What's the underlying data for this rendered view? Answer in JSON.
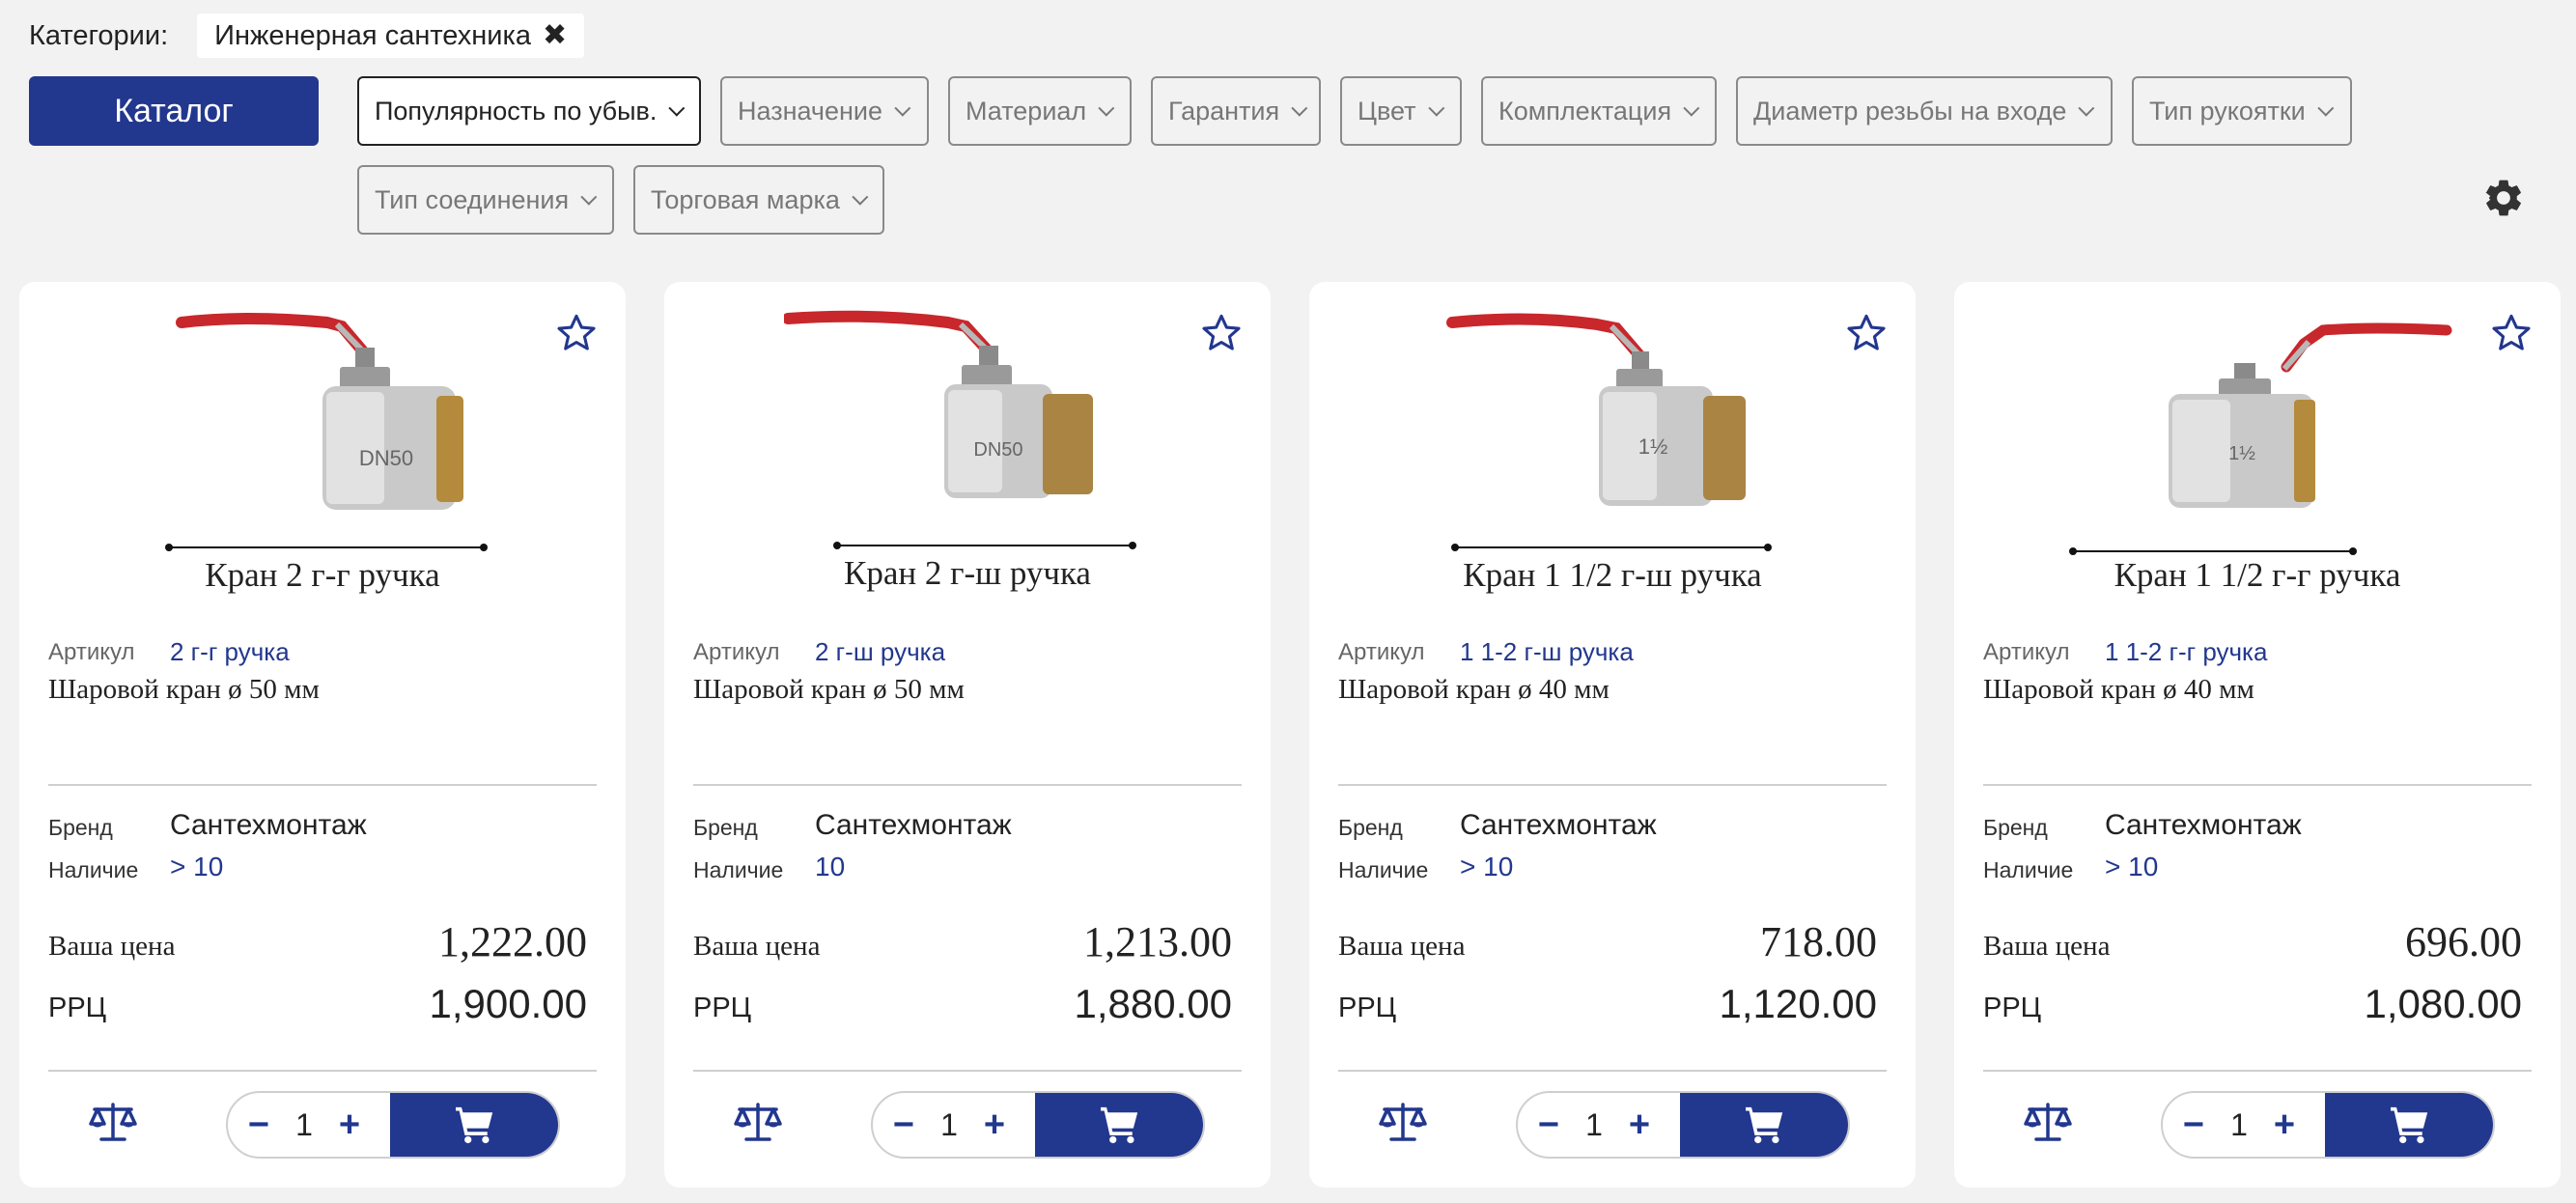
{
  "categories": {
    "label": "Категории:",
    "chip": "Инженерная сантехника",
    "chip_remove": "✖"
  },
  "catalog_button": "Каталог",
  "sort": "Популярность по убыв.",
  "filters": {
    "purpose": "Назначение",
    "material": "Материал",
    "warranty": "Гарантия",
    "color": "Цвет",
    "kit": "Комплектация",
    "thread_diameter": "Диаметр резьбы на входе",
    "handle_type": "Тип рукоятки",
    "connection_type": "Тип соединения",
    "brand": "Торговая марка"
  },
  "icons": {
    "settings": "gear-icon",
    "favorite": "star-icon",
    "compare": "scales-icon",
    "cart": "cart-icon"
  },
  "colors": {
    "accent": "#22378e",
    "handle_red": "#c8272c",
    "background": "#f2f2f2"
  },
  "labels": {
    "article": "Артикул",
    "brand": "Бренд",
    "stock": "Наличие",
    "your_price": "Ваша цена",
    "rrp": "РРЦ",
    "minus": "−",
    "plus": "+"
  },
  "products": [
    {
      "title": "Кран 2 г-г ручка",
      "article": "2 г-г ручка",
      "description": "Шаровой кран ø 50 мм",
      "brand": "Сантехмонтаж",
      "stock": "> 10",
      "price": "1,222.00",
      "rrp": "1,900.00",
      "qty": "1",
      "image_text": "DN50"
    },
    {
      "title": "Кран 2 г-ш ручка",
      "article": "2 г-ш ручка",
      "description": "Шаровой кран ø 50 мм",
      "brand": "Сантехмонтаж",
      "stock": "10",
      "price": "1,213.00",
      "rrp": "1,880.00",
      "qty": "1",
      "image_text": "DN50"
    },
    {
      "title": "Кран 1 1/2 г-ш ручка",
      "article": "1 1-2 г-ш ручка",
      "description": "Шаровой кран ø 40 мм",
      "brand": "Сантехмонтаж",
      "stock": "> 10",
      "price": "718.00",
      "rrp": "1,120.00",
      "qty": "1",
      "image_text": "1½"
    },
    {
      "title": "Кран 1 1/2 г-г ручка",
      "article": "1 1-2 г-г ручка",
      "description": "Шаровой кран ø 40 мм",
      "brand": "Сантехмонтаж",
      "stock": "> 10",
      "price": "696.00",
      "rrp": "1,080.00",
      "qty": "1",
      "image_text": "1½"
    }
  ]
}
